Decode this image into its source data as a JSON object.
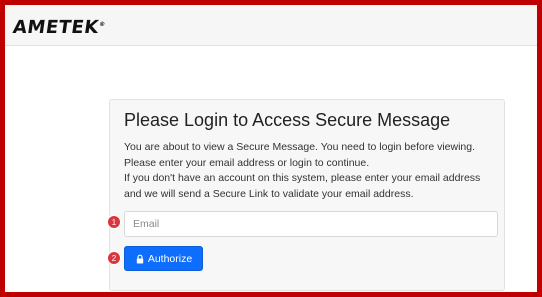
{
  "header": {
    "logo_text": "AMETEK",
    "logo_mark": "®"
  },
  "login_card": {
    "title": "Please Login to Access Secure Message",
    "description_lines": [
      "You are about to view a Secure Message. You need to login before viewing.",
      "Please enter your email address or login to continue.",
      "If you don't have an account on this system, please enter your email address",
      "and we will send a Secure Link to validate your email address."
    ],
    "email_placeholder": "Email",
    "email_value": "",
    "authorize_label": "Authorize",
    "authorize_icon": "lock-icon"
  },
  "annotations": {
    "step1": "1",
    "step2": "2"
  },
  "colors": {
    "frame_border": "#c00000",
    "primary_button": "#0d6efd",
    "step_badge": "#d9363e"
  }
}
